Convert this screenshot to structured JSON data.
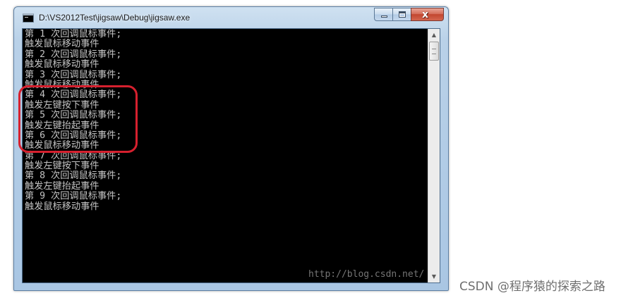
{
  "window": {
    "title": "D:\\VS2012Test\\jigsaw\\Debug\\jigsaw.exe",
    "icon": "console-app-icon",
    "buttons": {
      "minimize_icon": "minimize-icon",
      "maximize_icon": "maximize-icon",
      "close_glyph": "x"
    }
  },
  "console": {
    "text_color": "#c3c3c3",
    "background": "#000000",
    "lines": [
      "第 1 次回调鼠标事件;",
      "触发鼠标移动事件",
      "第 2 次回调鼠标事件;",
      "触发鼠标移动事件",
      "第 3 次回调鼠标事件;",
      "触发鼠标移动事件",
      "第 4 次回调鼠标事件;",
      "触发左键按下事件",
      "第 5 次回调鼠标事件;",
      "触发左键抬起事件",
      "第 6 次回调鼠标事件;",
      "触发鼠标移动事件",
      "第 7 次回调鼠标事件;",
      "触发左键按下事件",
      "第 8 次回调鼠标事件;",
      "触发左键抬起事件",
      "第 9 次回调鼠标事件;",
      "触发鼠标移动事件"
    ],
    "watermark": "http://blog.csdn.net/"
  },
  "annotation": {
    "highlight_color": "#d6202e"
  },
  "footer": {
    "watermark": "CSDN @程序猿的探索之路"
  }
}
